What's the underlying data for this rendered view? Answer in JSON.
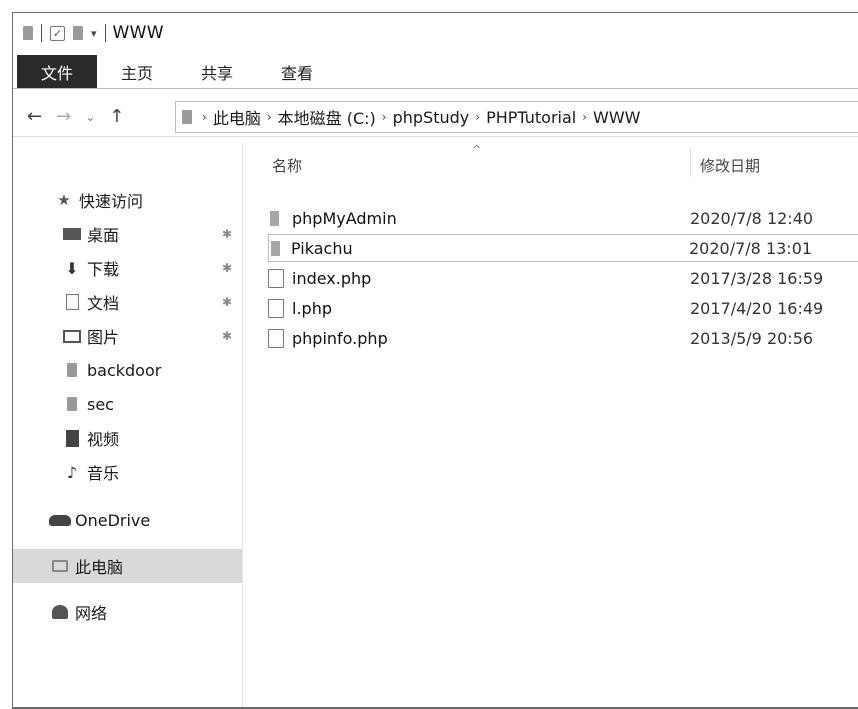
{
  "window": {
    "title": "WWW",
    "qa_check": "✓",
    "qa_dropdown": "▾"
  },
  "ribbon": {
    "tabs": [
      {
        "label": "文件",
        "active": true
      },
      {
        "label": "主页",
        "active": false
      },
      {
        "label": "共享",
        "active": false
      },
      {
        "label": "查看",
        "active": false
      }
    ]
  },
  "address": {
    "back": "←",
    "forward": "→",
    "recent": "⌄",
    "up": "↑",
    "path": [
      "此电脑",
      "本地磁盘 (C:)",
      "phpStudy",
      "PHPTutorial",
      "WWW"
    ],
    "separator": "›"
  },
  "sidebar": {
    "quick_access": "快速访问",
    "items": [
      {
        "label": "桌面",
        "icon": "desktop-icon",
        "pinned": true
      },
      {
        "label": "下载",
        "icon": "download-icon",
        "pinned": true
      },
      {
        "label": "文档",
        "icon": "document-icon",
        "pinned": true
      },
      {
        "label": "图片",
        "icon": "pictures-icon",
        "pinned": true
      },
      {
        "label": "backdoor",
        "icon": "folder-icon",
        "pinned": false
      },
      {
        "label": "sec",
        "icon": "folder-icon",
        "pinned": false
      },
      {
        "label": "视频",
        "icon": "video-icon",
        "pinned": false
      },
      {
        "label": "音乐",
        "icon": "music-icon",
        "pinned": false
      }
    ],
    "onedrive": "OneDrive",
    "this_pc": "此电脑",
    "network": "网络",
    "pin_glyph": "✱"
  },
  "content": {
    "columns": {
      "name": "名称",
      "modified": "修改日期"
    },
    "sort_glyph": "^",
    "files": [
      {
        "name": "phpMyAdmin",
        "date": "2020/7/8 12:40",
        "type": "folder"
      },
      {
        "name": "Pikachu",
        "date": "2020/7/8 13:01",
        "type": "folder"
      },
      {
        "name": "index.php",
        "date": "2017/3/28 16:59",
        "type": "file"
      },
      {
        "name": "l.php",
        "date": "2017/4/20 16:49",
        "type": "file"
      },
      {
        "name": "phpinfo.php",
        "date": "2013/5/9 20:56",
        "type": "file"
      }
    ]
  }
}
